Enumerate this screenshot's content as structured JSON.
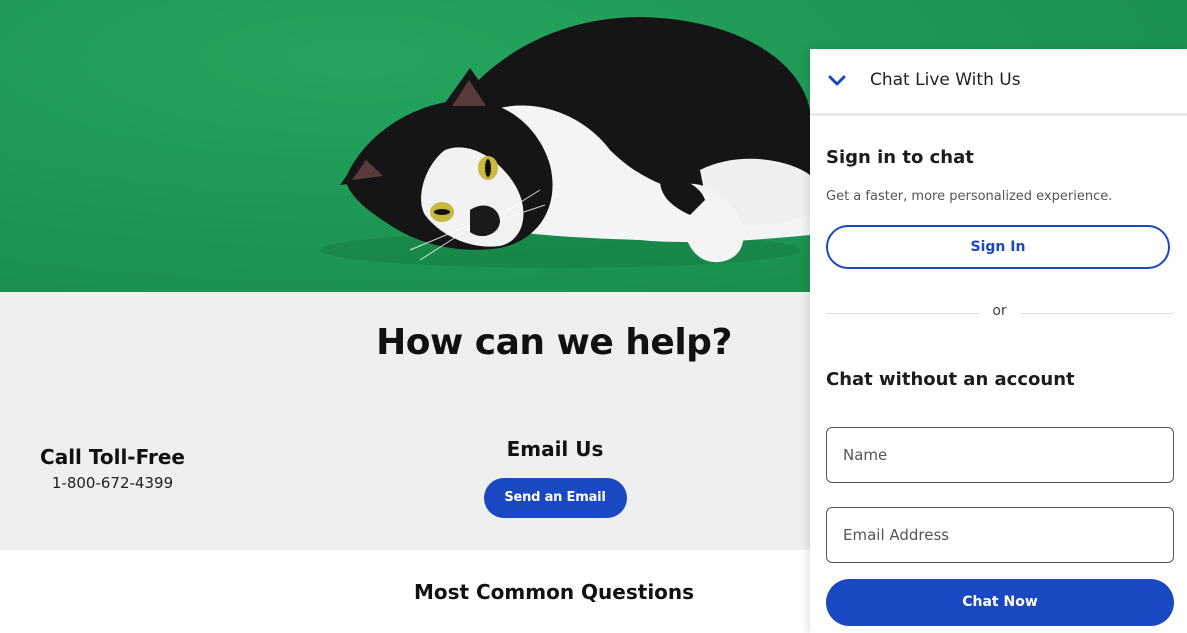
{
  "help": {
    "title": "How can we help?",
    "call": {
      "heading": "Call Toll-Free",
      "phone": "1-800-672-4399"
    },
    "email": {
      "heading": "Email Us",
      "button_label": "Send an Email"
    }
  },
  "questions": {
    "title": "Most Common Questions"
  },
  "chat": {
    "header_title": "Chat Live With Us",
    "signin_heading": "Sign in to chat",
    "signin_subtext": "Get a faster, more personalized experience.",
    "signin_button": "Sign In",
    "divider_text": "or",
    "noaccount_heading": "Chat without an account",
    "name_placeholder": "Name",
    "email_placeholder": "Email Address",
    "chat_now_button": "Chat Now"
  },
  "colors": {
    "brand_blue": "#1a47c2",
    "hero_green": "#1f9a57",
    "section_gray": "#efefef"
  },
  "icons": {
    "collapse": "chevron-down-icon"
  }
}
